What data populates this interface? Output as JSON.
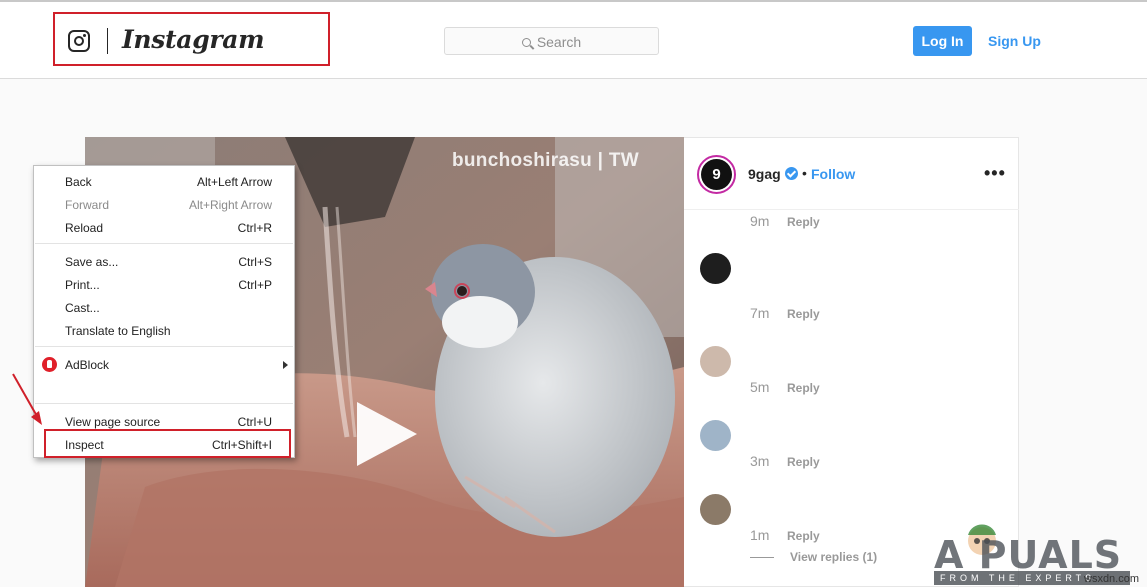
{
  "header": {
    "brand_name": "Instagram",
    "search": {
      "placeholder": "Search"
    },
    "login_label": "Log In",
    "signup_label": "Sign Up"
  },
  "post": {
    "video_watermark": "bunchoshirasu | TW",
    "author": {
      "username": "9gag",
      "avatar_text": "9",
      "verified": true
    },
    "follow_label": "Follow",
    "comments": [
      {
        "text": "",
        "time": "9m",
        "reply_label": "Reply"
      },
      {
        "text": "",
        "time": "7m",
        "reply_label": "Reply"
      },
      {
        "text": "",
        "time": "5m",
        "reply_label": "Reply"
      },
      {
        "text": "",
        "time": "3m",
        "reply_label": "Reply"
      },
      {
        "text": "",
        "time": "1m",
        "reply_label": "Reply"
      }
    ],
    "view_replies_label": "View replies (1)"
  },
  "context_menu": {
    "items": [
      {
        "label": "Back",
        "shortcut": "Alt+Left Arrow",
        "enabled": true
      },
      {
        "label": "Forward",
        "shortcut": "Alt+Right Arrow",
        "enabled": false
      },
      {
        "label": "Reload",
        "shortcut": "Ctrl+R",
        "enabled": true
      },
      {
        "label": "Save as...",
        "shortcut": "Ctrl+S",
        "enabled": true
      },
      {
        "label": "Print...",
        "shortcut": "Ctrl+P",
        "enabled": true
      },
      {
        "label": "Cast...",
        "shortcut": "",
        "enabled": true
      },
      {
        "label": "Translate to English",
        "shortcut": "",
        "enabled": true
      },
      {
        "label": "AdBlock",
        "shortcut": "",
        "enabled": true,
        "icon": "adblock-hand-icon",
        "has_submenu": true
      },
      {
        "label": "View page source",
        "shortcut": "Ctrl+U",
        "enabled": true
      },
      {
        "label": "Inspect",
        "shortcut": "Ctrl+Shift+I",
        "enabled": true,
        "highlighted": true
      }
    ]
  },
  "overlay": {
    "brand_text": "A PUALS",
    "brand_tagline": "FROM THE EXPERTS",
    "site_credit": "wsxdn.com"
  },
  "colors": {
    "accent_blue": "#3897f0",
    "highlight_red": "#d0202a",
    "text_dark": "#262626",
    "text_muted": "#999999"
  }
}
